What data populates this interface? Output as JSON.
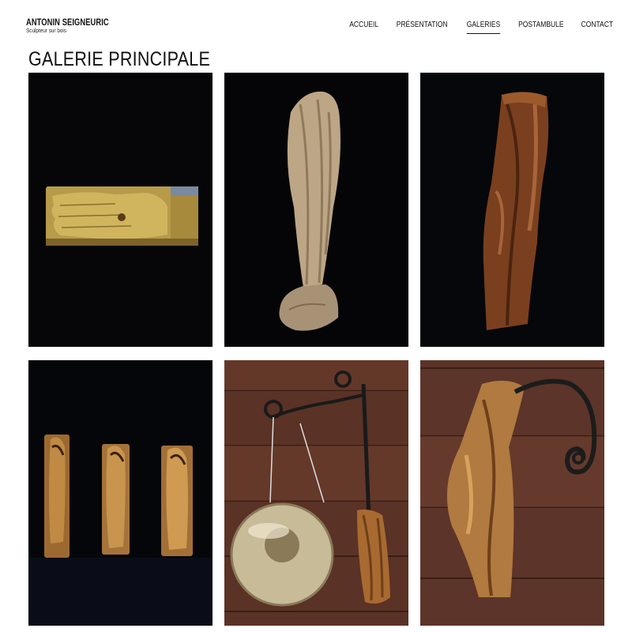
{
  "brand": {
    "name": "ANTONIN SEIGNEURIC",
    "tagline": "Sculpteur sur bois"
  },
  "nav": {
    "items": [
      {
        "label": "ACCUEIL",
        "active": false
      },
      {
        "label": "PRÉSENTATION",
        "active": false
      },
      {
        "label": "GALERIES",
        "active": true
      },
      {
        "label": "POSTAMBULE",
        "active": false
      },
      {
        "label": "CONTACT",
        "active": false
      }
    ]
  },
  "page": {
    "title": "GALERIE PRINCIPALE"
  },
  "gallery": {
    "items": [
      {
        "subject": "wooden-hand-sculpture"
      },
      {
        "subject": "draped-figure-sculpture"
      },
      {
        "subject": "carved-trunk-sculpture"
      },
      {
        "subject": "three-relief-figures"
      },
      {
        "subject": "gong-with-carved-wood"
      },
      {
        "subject": "wooden-sculpture-iron-scroll"
      }
    ]
  },
  "colors": {
    "background": "#ffffff",
    "text": "#111111",
    "photo_dark": "#060608",
    "wall_wood": "#5a3226"
  }
}
